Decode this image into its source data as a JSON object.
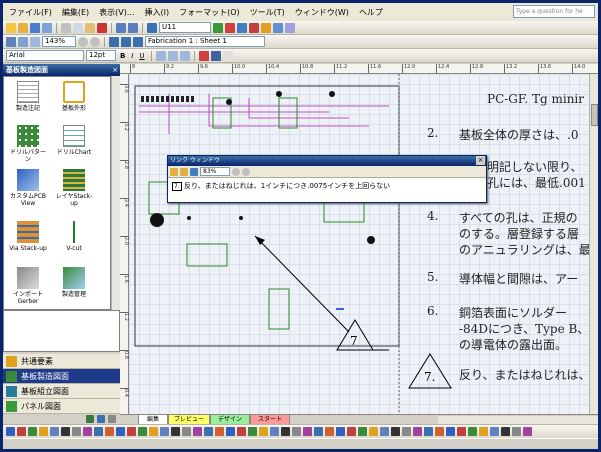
{
  "menu": [
    "ファイル(F)",
    "編集(E)",
    "表示(V)...",
    "挿入(I)",
    "フォーマット(O)",
    "ツール(T)",
    "ウィンドウ(W)",
    "ヘルプ"
  ],
  "help_placeholder": "Type a question for he",
  "toolbar1": {
    "font_size_combo": "U11"
  },
  "toolbar2": {
    "zoom": "143%",
    "page_selector": "Fabrication 1 : Sheet 1"
  },
  "toolbar3": {
    "font": "Arial",
    "size": "12pt"
  },
  "left_panel": {
    "title": "基板製造図面",
    "shapes": [
      {
        "label": "製造注記"
      },
      {
        "label": "基板外形"
      },
      {
        "label": "ドリルパターン"
      },
      {
        "label": "ドリルChart"
      },
      {
        "label": "カスタムPCB View"
      },
      {
        "label": "レイヤStack-up"
      },
      {
        "label": "Via Stack-up"
      },
      {
        "label": "V-cut"
      },
      {
        "label": "インポートGerber"
      },
      {
        "label": "製造管理"
      }
    ],
    "stencils": [
      {
        "label": "共通要素",
        "active": false
      },
      {
        "label": "基板製造図面",
        "active": true
      },
      {
        "label": "基板組立図面",
        "active": false
      },
      {
        "label": "パネル図面",
        "active": false
      }
    ]
  },
  "ruler_ticks": [
    "8",
    "9.2",
    "9.6",
    "10.0",
    "10.4",
    "10.8",
    "11.2",
    "11.6",
    "12.0",
    "12.4",
    "12.8",
    "13.2",
    "13.6",
    "14.0"
  ],
  "ruler_left_ticks": [
    "3.6",
    "3.2",
    "2.8",
    "2.4",
    "2.0",
    "1.6",
    "1.2",
    "0.8",
    "0.4"
  ],
  "notes": {
    "header": "PC-GF. Tg minir",
    "items": [
      {
        "num": "2.",
        "text": "基板全体の厚さは、.0"
      },
      {
        "num": "",
        "text": "明記しない限り、"
      },
      {
        "num": "",
        "text": "孔には、最低.001"
      },
      {
        "num": "4.",
        "text": "すべての孔は、正規の"
      },
      {
        "num": "",
        "text": "のする。層登録する層"
      },
      {
        "num": "",
        "text": "のアニュラリングは、最"
      },
      {
        "num": "5.",
        "text": "導体幅と間隙は、アー"
      },
      {
        "num": "6.",
        "text": "銅箔表面にソルダー"
      },
      {
        "num": "",
        "text": "-84Dにつき、Type B、"
      },
      {
        "num": "",
        "text": "の導電体の露出面。"
      },
      {
        "num": "",
        "text": "反り、またはねじれは、"
      }
    ],
    "tri7_label": "7",
    "tri7b_label": "7."
  },
  "link_window": {
    "title": "リンク ウィンドウ",
    "zoom": "83%",
    "row_num": "7.",
    "row_text": "反り、またはねじれは、1インチにつき.0075インチを上回らない"
  },
  "tabs": [
    "編集",
    "プレビュー",
    "デザイン",
    "スタート"
  ]
}
